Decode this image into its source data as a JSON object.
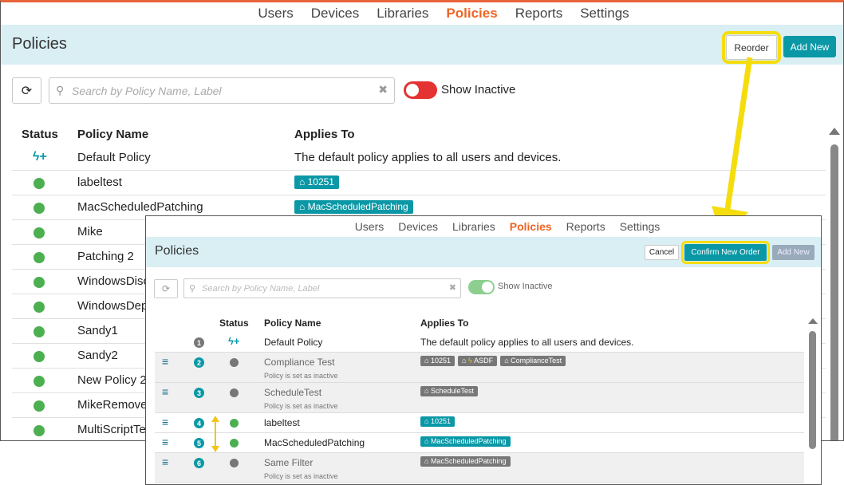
{
  "back": {
    "nav": [
      "Users",
      "Devices",
      "Libraries",
      "Policies",
      "Reports",
      "Settings"
    ],
    "nav_active": "Policies",
    "title": "Policies",
    "reorder_label": "Reorder",
    "add_new_label": "Add New",
    "search_placeholder": "Search by Policy Name, Label",
    "show_inactive_label": "Show Inactive",
    "columns": {
      "status": "Status",
      "name": "Policy Name",
      "applies": "Applies To"
    },
    "rows": [
      {
        "name": "Default Policy",
        "applies": "The default policy applies to all users and devices.",
        "tag": ""
      },
      {
        "name": "labeltest",
        "applies": "",
        "tag": "10251"
      },
      {
        "name": "MacScheduledPatching",
        "applies": "",
        "tag": "MacScheduledPatching"
      },
      {
        "name": "Mike",
        "applies": "",
        "tag": ""
      },
      {
        "name": "Patching 2",
        "applies": "",
        "tag": ""
      },
      {
        "name": "WindowsDisc",
        "applies": "",
        "tag": ""
      },
      {
        "name": "WindowsDep",
        "applies": "",
        "tag": ""
      },
      {
        "name": "Sandy1",
        "applies": "",
        "tag": ""
      },
      {
        "name": "Sandy2",
        "applies": "",
        "tag": ""
      },
      {
        "name": "New Policy 2",
        "applies": "",
        "tag": ""
      },
      {
        "name": "MikeRemove",
        "applies": "",
        "tag": ""
      },
      {
        "name": "MultiScriptTe",
        "applies": "",
        "tag": ""
      }
    ]
  },
  "front": {
    "nav": [
      "Users",
      "Devices",
      "Libraries",
      "Policies",
      "Reports",
      "Settings"
    ],
    "nav_active": "Policies",
    "title": "Policies",
    "cancel_label": "Cancel",
    "confirm_label": "Confirm New Order",
    "add_new_label": "Add New",
    "search_placeholder": "Search by Policy Name, Label",
    "show_inactive_label": "Show Inactive",
    "columns": {
      "status": "Status",
      "name": "Policy Name",
      "applies": "Applies To"
    },
    "inactive_note": "Policy is set as inactive",
    "rows": [
      {
        "order": "1",
        "name": "Default Policy",
        "applies": "The default policy applies to all users and devices.",
        "tags": [],
        "active": true,
        "inactive": false
      },
      {
        "order": "2",
        "name": "Compliance Test",
        "applies": "",
        "tags": [
          "10251",
          "ASDF",
          "ComplianceTest"
        ],
        "active": false,
        "inactive": true
      },
      {
        "order": "3",
        "name": "ScheduleTest",
        "applies": "",
        "tags": [
          "ScheduleTest"
        ],
        "active": false,
        "inactive": true
      },
      {
        "order": "4",
        "name": "labeltest",
        "applies": "",
        "tags": [
          "10251"
        ],
        "active": true,
        "inactive": false
      },
      {
        "order": "5",
        "name": "MacScheduledPatching",
        "applies": "",
        "tags": [
          "MacScheduledPatching"
        ],
        "active": true,
        "inactive": false
      },
      {
        "order": "6",
        "name": "Same Filter",
        "applies": "",
        "tags": [
          "MacScheduledPatching"
        ],
        "active": false,
        "inactive": true
      }
    ]
  },
  "colors": {
    "accent": "#0a98a6",
    "active_nav": "#ee6424",
    "highlight": "#f5dd0d",
    "status_ok": "#4caf50"
  }
}
